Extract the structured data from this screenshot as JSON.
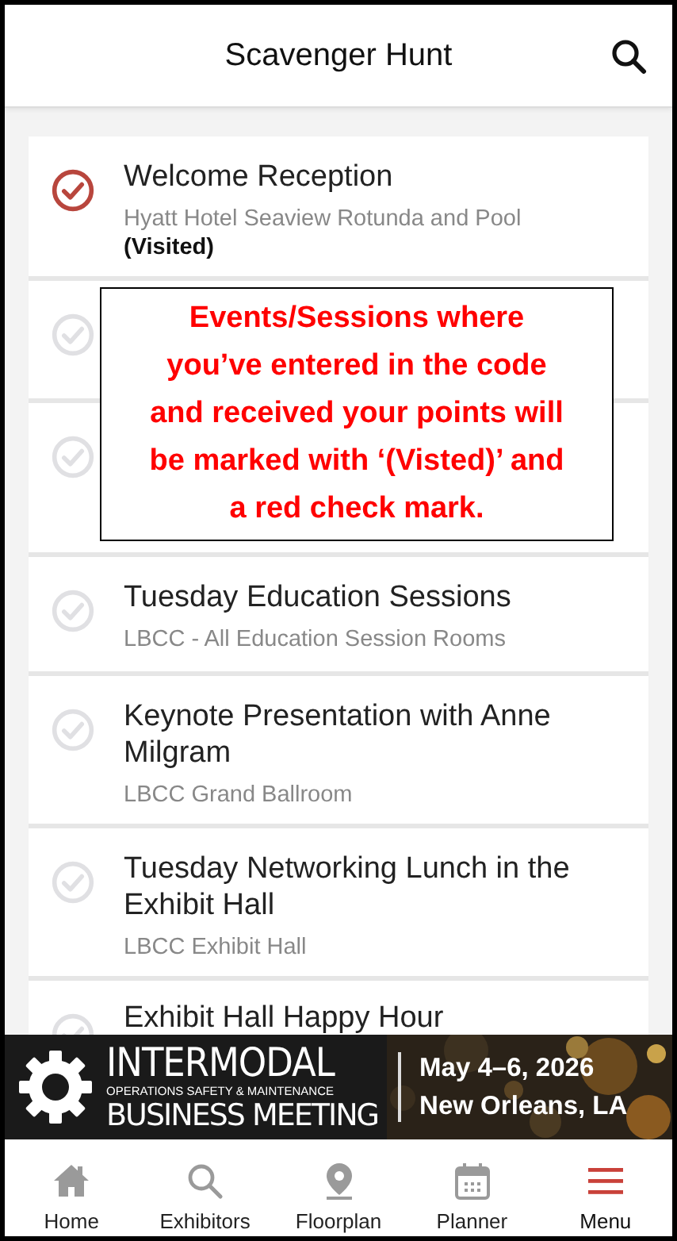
{
  "header": {
    "title": "Scavenger Hunt"
  },
  "items": [
    {
      "title": "Welcome Reception",
      "location": "Hyatt Hotel Seaview Rotunda and Pool",
      "visited": true,
      "status": "(Visited)"
    },
    {
      "visited": false
    },
    {
      "visited": false
    },
    {
      "title": "Tuesday Education Sessions",
      "location": "LBCC - All Education Session Rooms",
      "visited": false
    },
    {
      "title": "Keynote Presentation with Anne Milgram",
      "location": "LBCC Grand Ballroom",
      "visited": false
    },
    {
      "title": "Tuesday Networking Lunch in the Exhibit Hall",
      "location": "LBCC Exhibit Hall",
      "visited": false
    },
    {
      "title": "Exhibit Hall Happy Hour",
      "visited": false
    }
  ],
  "callout": {
    "text": "Events/Sessions where you’ve entered in the code and received your points will be marked with ‘(Visted)’ and a red check mark."
  },
  "banner": {
    "name": "INTERMODAL",
    "subtitle": "OPERATIONS SAFETY & MAINTENANCE",
    "name_line_2": "BUSINESS MEETING",
    "dates": "May 4–6, 2026",
    "place": "New Orleans, LA"
  },
  "nav": [
    {
      "label": "Home",
      "selected": false
    },
    {
      "label": "Exhibitors",
      "selected": false
    },
    {
      "label": "Floorplan",
      "selected": false
    },
    {
      "label": "Planner",
      "selected": false
    },
    {
      "label": "Menu",
      "selected": true
    }
  ]
}
